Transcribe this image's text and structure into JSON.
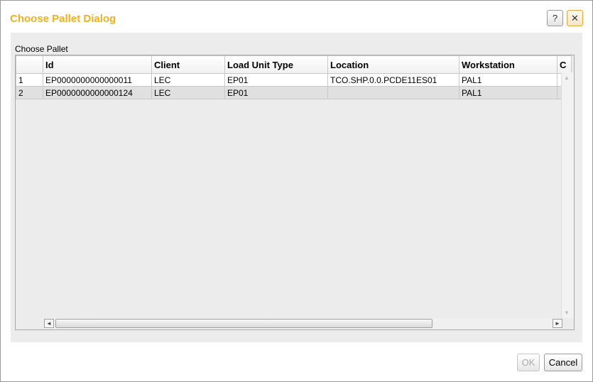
{
  "dialog": {
    "title": "Choose Pallet Dialog",
    "help_label": "?",
    "close_label": "✕"
  },
  "panel": {
    "label": "Choose Pallet"
  },
  "grid": {
    "columns": [
      "",
      "Id",
      "Client",
      "Load Unit Type",
      "Location",
      "Workstation",
      "C"
    ],
    "rows": [
      [
        "1",
        "EP0000000000000011",
        "LEC",
        "EP01",
        "TCO.SHP.0.0.PCDE11ES01",
        "PAL1",
        ""
      ],
      [
        "2",
        "EP0000000000000124",
        "LEC",
        "EP01",
        "",
        "PAL1",
        ""
      ]
    ]
  },
  "scroll": {
    "up_arrow": "▲",
    "down_arrow": "▼",
    "left_arrow": "◄",
    "right_arrow": "►"
  },
  "footer": {
    "ok_label": "OK",
    "cancel_label": "Cancel"
  },
  "colors": {
    "title": "#f2b01e",
    "panel_bg": "#ececec",
    "selected_row": "#e0e0e0"
  }
}
